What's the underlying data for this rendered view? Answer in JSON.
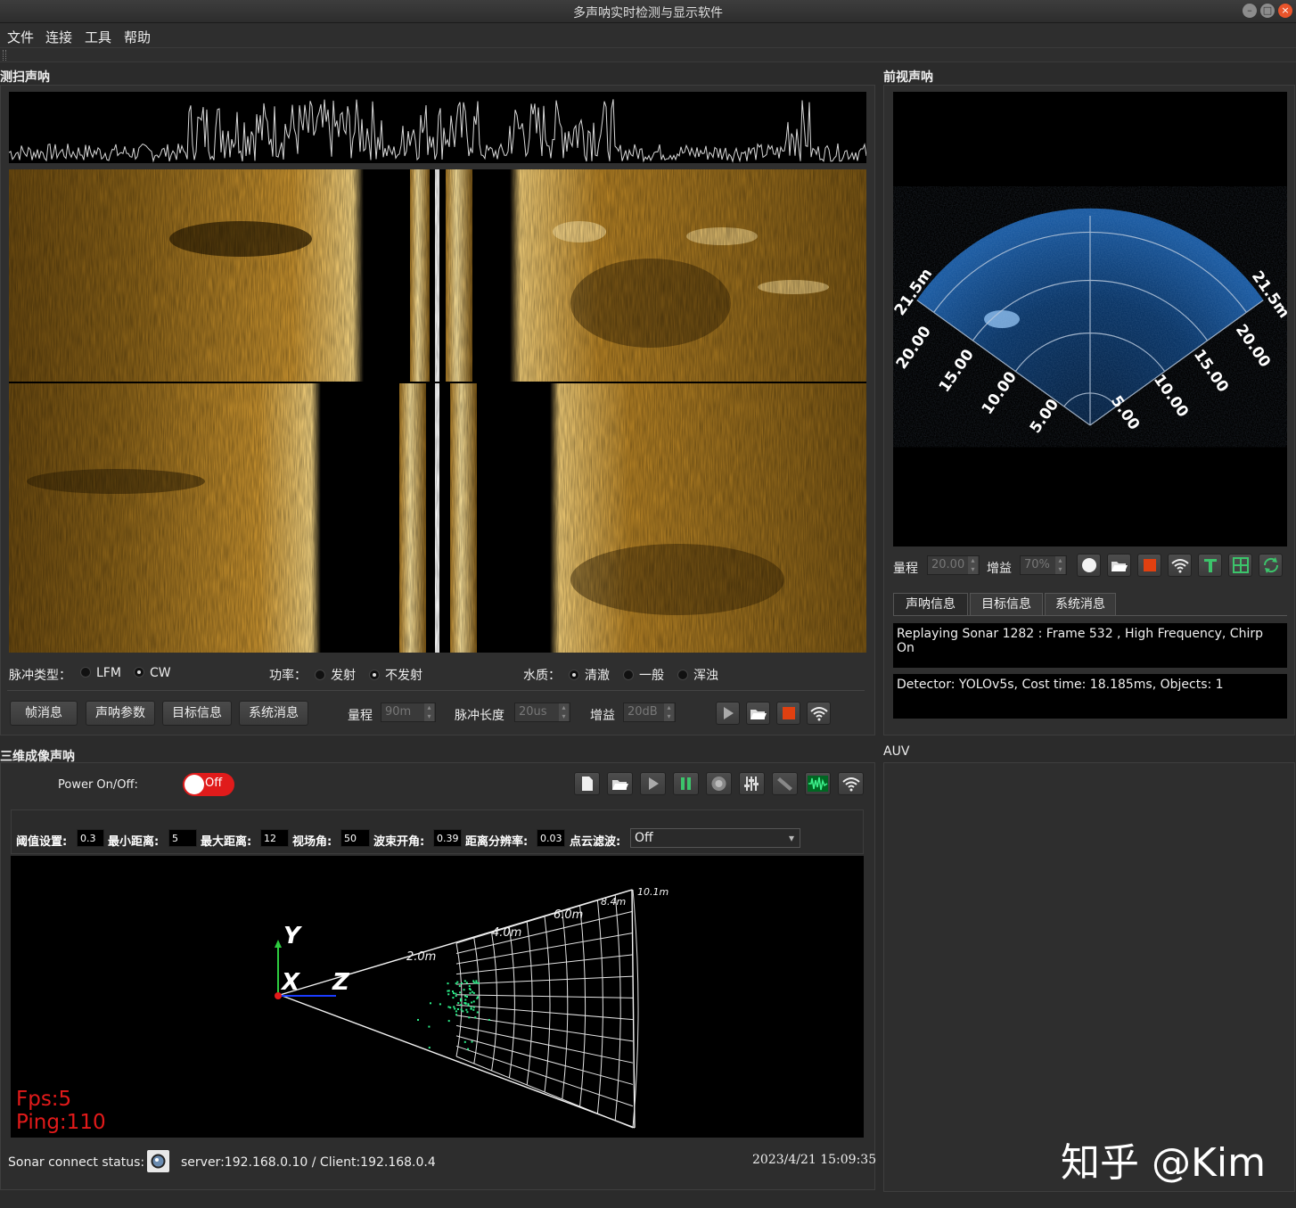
{
  "window": {
    "title": "多声呐实时检测与显示软件",
    "min": "–",
    "max": "□",
    "close": "×"
  },
  "menu": [
    "文件",
    "连接",
    "工具",
    "帮助"
  ],
  "sidescan": {
    "title": "测扫声呐",
    "pulse_type_label": "脉冲类型：",
    "pulse_options": [
      "LFM",
      "CW"
    ],
    "pulse_selected": "CW",
    "power_label": "功率：",
    "power_options": [
      "发射",
      "不发射"
    ],
    "power_selected": "不发射",
    "water_label": "水质：",
    "water_options": [
      "清澈",
      "一般",
      "浑浊"
    ],
    "water_selected": "清澈",
    "buttons": [
      "帧消息",
      "声呐参数",
      "目标信息",
      "系统消息"
    ],
    "range_label": "量程",
    "range_value": "90m",
    "pulse_len_label": "脉冲长度",
    "pulse_len_value": "20us",
    "gain_label": "增益",
    "gain_value": "20dB",
    "toolbar_icons": [
      "play-icon",
      "open-folder-icon",
      "stop-icon",
      "wifi-icon"
    ]
  },
  "front_sonar": {
    "title": "前视声呐",
    "range_label": "量程",
    "range_value": "20.00",
    "gain_label": "增益",
    "gain_value": "70%",
    "range_ring_labels_left": [
      "21.5m",
      "20.00",
      "15.00",
      "10.00",
      "5.00"
    ],
    "range_ring_labels_right": [
      "21.5m",
      "20.00",
      "15.00",
      "10.00",
      "5.00"
    ],
    "toolbar_icons": [
      "circle-icon",
      "open-folder-icon",
      "stop-icon",
      "wifi-icon",
      "text-icon",
      "grid-icon",
      "refresh-icon"
    ],
    "tabs": [
      "声呐信息",
      "目标信息",
      "系统消息"
    ],
    "active_tab": "声呐信息",
    "sonar_info": "Replaying Sonar 1282 : Frame 532 , High Frequency, Chirp On",
    "detector_info": "Detector: YOLOv5s, Cost time: 18.185ms, Objects: 1"
  },
  "auv": {
    "title": "AUV"
  },
  "sonar3d": {
    "title": "三维成像声呐",
    "power_label": "Power On/Off:",
    "power_state": "Off",
    "toolbar_icons": [
      "new-file-icon",
      "open-folder-icon",
      "play-icon",
      "pause-icon",
      "record-icon",
      "equalizer-icon",
      "paint-icon",
      "waveform-icon",
      "wifi-icon"
    ],
    "params": [
      {
        "label": "阈值设置:",
        "value": "0.3"
      },
      {
        "label": "最小距离:",
        "value": "5"
      },
      {
        "label": "最大距离:",
        "value": "12"
      },
      {
        "label": "视场角:",
        "value": "50"
      },
      {
        "label": "波束开角:",
        "value": "0.39"
      },
      {
        "label": "距离分辨率:",
        "value": "0.03"
      }
    ],
    "filter_label": "点云滤波:",
    "filter_value": "Off",
    "axis_labels": [
      "Y",
      "X",
      "Z"
    ],
    "distance_labels": [
      "2.0m",
      "4.0m",
      "6.0m",
      "8.4m",
      "10.1m"
    ],
    "fps": "Fps:5",
    "ping": "Ping:110",
    "connect_label": "Sonar connect status:",
    "server_text": "server:192.168.0.10 / Client:192.168.0.4",
    "timestamp": "2023/4/21  15:09:35"
  },
  "watermark": "知乎 @Kim"
}
